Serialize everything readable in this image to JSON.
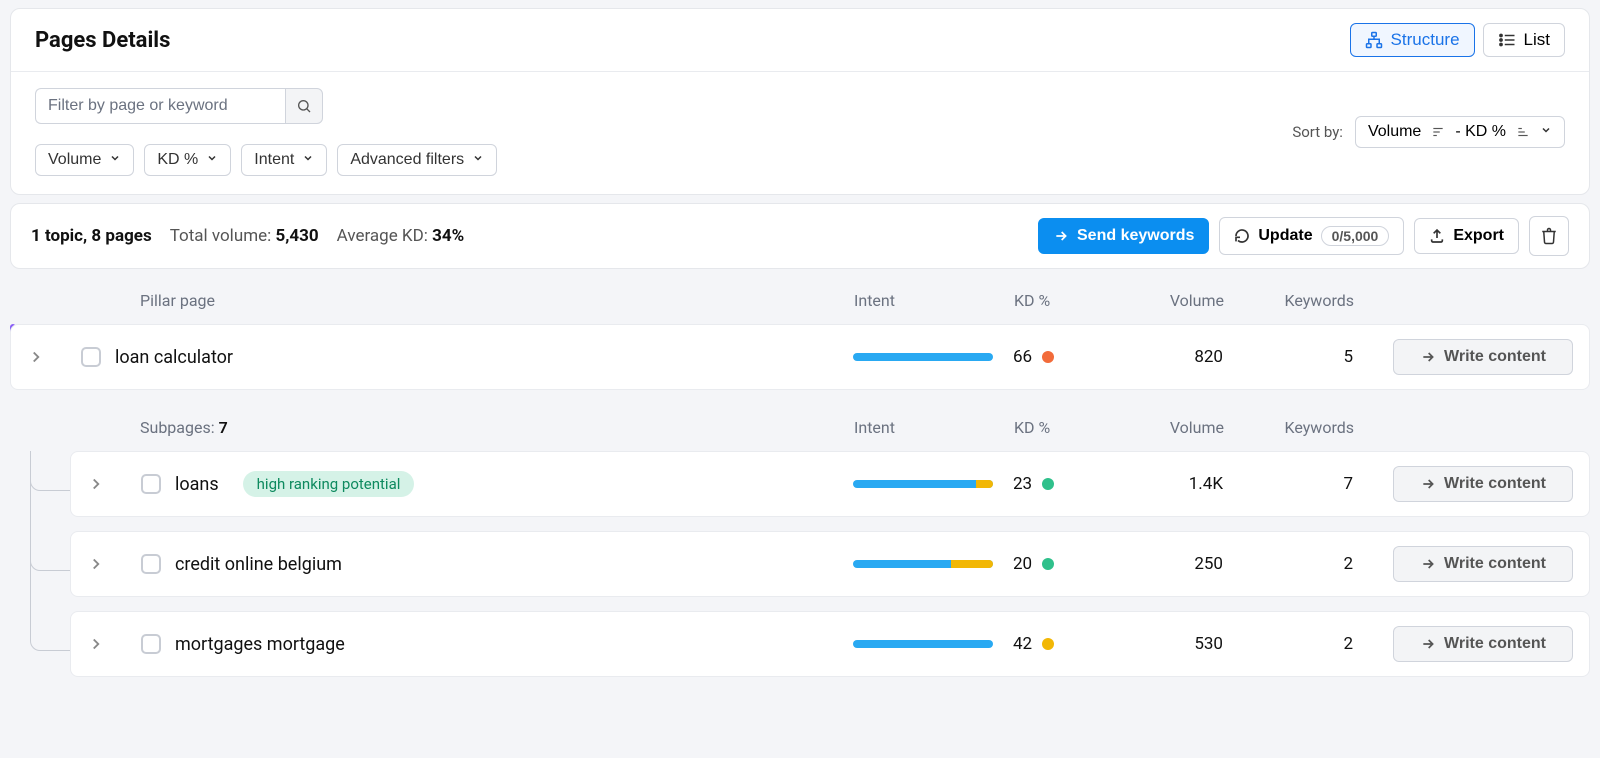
{
  "header": {
    "title": "Pages Details",
    "structure_label": "Structure",
    "list_label": "List"
  },
  "filters": {
    "search_placeholder": "Filter by page or keyword",
    "chips": [
      "Volume",
      "KD %",
      "Intent",
      "Advanced filters"
    ],
    "sort_label": "Sort by:",
    "sort_value_a": "Volume",
    "sort_value_b": "- KD %"
  },
  "summary": {
    "topics_pages": "1 topic, 8 pages",
    "total_volume_label": "Total volume:",
    "total_volume_value": "5,430",
    "avg_kd_label": "Average KD:",
    "avg_kd_value": "34%",
    "send_label": "Send keywords",
    "update_label": "Update",
    "update_counter": "0/5,000",
    "export_label": "Export"
  },
  "columns": {
    "pillar": "Pillar page",
    "intent": "Intent",
    "kd": "KD %",
    "volume": "Volume",
    "keywords": "Keywords",
    "subpages_label": "Subpages:",
    "subpages_count": "7"
  },
  "write_label": "Write content",
  "pillar_row": {
    "name": "loan calculator",
    "intent_seg2_pct": 0,
    "kd": "66",
    "kd_color": "#f26b3a",
    "volume": "820",
    "keywords": "5"
  },
  "subpages": [
    {
      "name": "loans",
      "badge": "high ranking potential",
      "intent_seg2_pct": 12,
      "kd": "23",
      "kd_color": "#2fc08b",
      "volume": "1.4K",
      "keywords": "7"
    },
    {
      "name": "credit online belgium",
      "badge": "",
      "intent_seg2_pct": 30,
      "kd": "20",
      "kd_color": "#2fc08b",
      "volume": "250",
      "keywords": "2"
    },
    {
      "name": "mortgages mortgage",
      "badge": "",
      "intent_seg2_pct": 0,
      "kd": "42",
      "kd_color": "#f2b705",
      "volume": "530",
      "keywords": "2"
    }
  ]
}
